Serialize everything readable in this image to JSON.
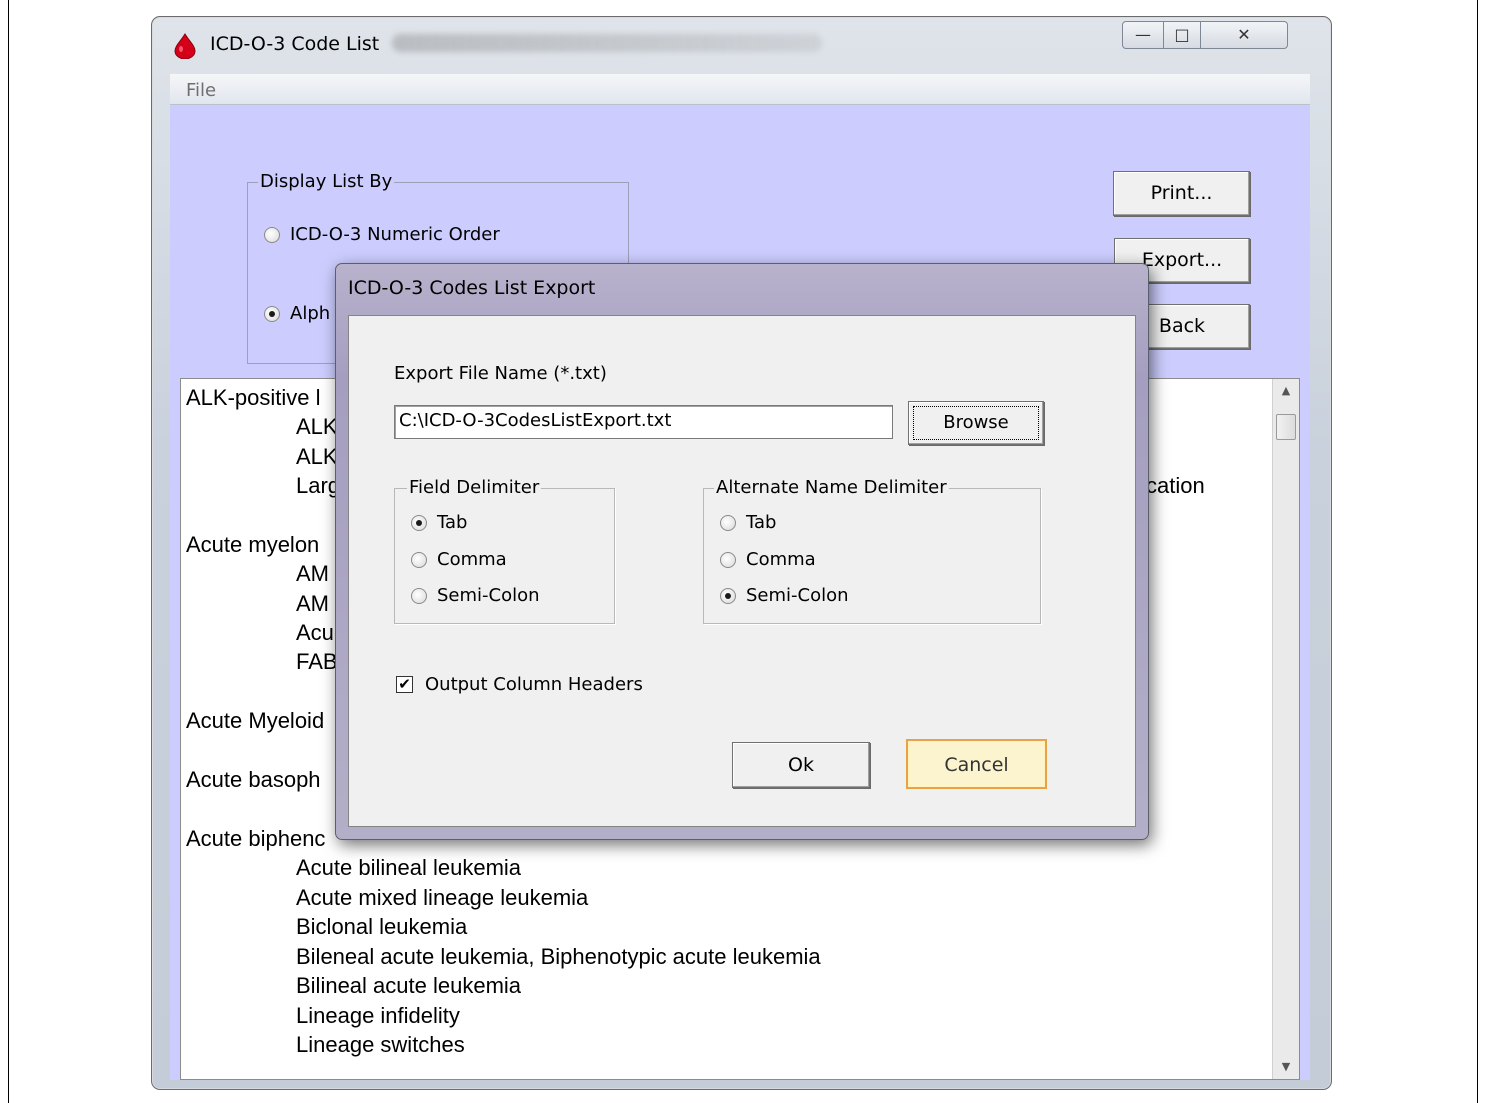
{
  "window": {
    "title": "ICD-O-3 Code List",
    "controls": {
      "minimize": "—",
      "maximize": "□",
      "close": "✕"
    },
    "icon": "blood-drop-icon"
  },
  "menu": {
    "file": "File"
  },
  "display_list_by": {
    "legend": "Display List By",
    "options": [
      {
        "label": "ICD-O-3 Numeric Order",
        "selected": false
      },
      {
        "label": "Alph",
        "selected": true
      }
    ]
  },
  "buttons": {
    "print": "Print...",
    "export": "Export...",
    "back": "Back"
  },
  "list": {
    "lines": [
      "ALK-positive l",
      "ALK",
      "ALK",
      "Larg",
      "Acute  myelon",
      "AM",
      "AM",
      "Acu",
      "FAB",
      "Acute Myeloid",
      "Acute basoph",
      "Acute biphenc",
      "Acute bilineal leukemia",
      "Acute mixed lineage leukemia",
      "Biclonal leukemia",
      "Bileneal acute leukemia, Biphenotypic acute leukemia",
      "Bilineal acute leukemia",
      "Lineage infidelity",
      "Lineage switches"
    ],
    "partial_right": "cation"
  },
  "dialog": {
    "title": "ICD-O-3 Codes List Export",
    "file_label": "Export File Name (*.txt)",
    "file_value": "C:\\ICD-O-3CodesListExport.txt",
    "browse": "Browse",
    "field_delimiter": {
      "legend": "Field Delimiter",
      "options": [
        {
          "label": "Tab",
          "selected": true
        },
        {
          "label": "Comma",
          "selected": false
        },
        {
          "label": "Semi-Colon",
          "selected": false
        }
      ]
    },
    "alt_name_delimiter": {
      "legend": "Alternate Name Delimiter",
      "options": [
        {
          "label": "Tab",
          "selected": false
        },
        {
          "label": "Comma",
          "selected": false
        },
        {
          "label": "Semi-Colon",
          "selected": true
        }
      ]
    },
    "output_headers": {
      "label": "Output Column Headers",
      "checked": true,
      "mark": "✔"
    },
    "ok": "Ok",
    "cancel": "Cancel"
  }
}
